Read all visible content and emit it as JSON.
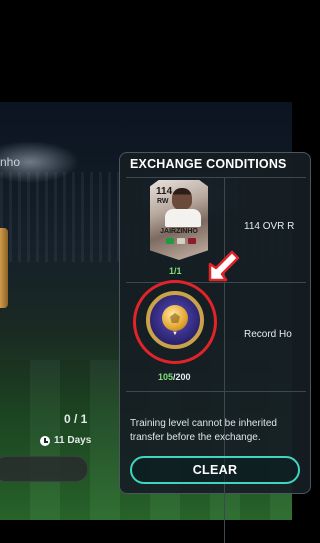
{
  "background": {
    "left_player_name_partial": "nho",
    "left_count": "0 / 1",
    "left_days": "11 Days"
  },
  "panel": {
    "title": "EXCHANGE CONDITIONS",
    "requirements": [
      {
        "card": {
          "ovr": "114",
          "position": "RW",
          "name": "JAIRZINHO"
        },
        "count": "1/1",
        "text": "114 OVR R"
      },
      {
        "item_icon": "gold-football-coin-icon",
        "count_current": "105",
        "count_max": "/200",
        "text": "Record Ho"
      }
    ],
    "notice_lines": [
      "Training level cannot be inherited",
      "transfer before the exchange."
    ],
    "clear_label": "CLEAR",
    "colors": {
      "count_green": "#7fe07a",
      "highlight_red": "#e0242a",
      "button_border": "#3fd5c0"
    }
  }
}
